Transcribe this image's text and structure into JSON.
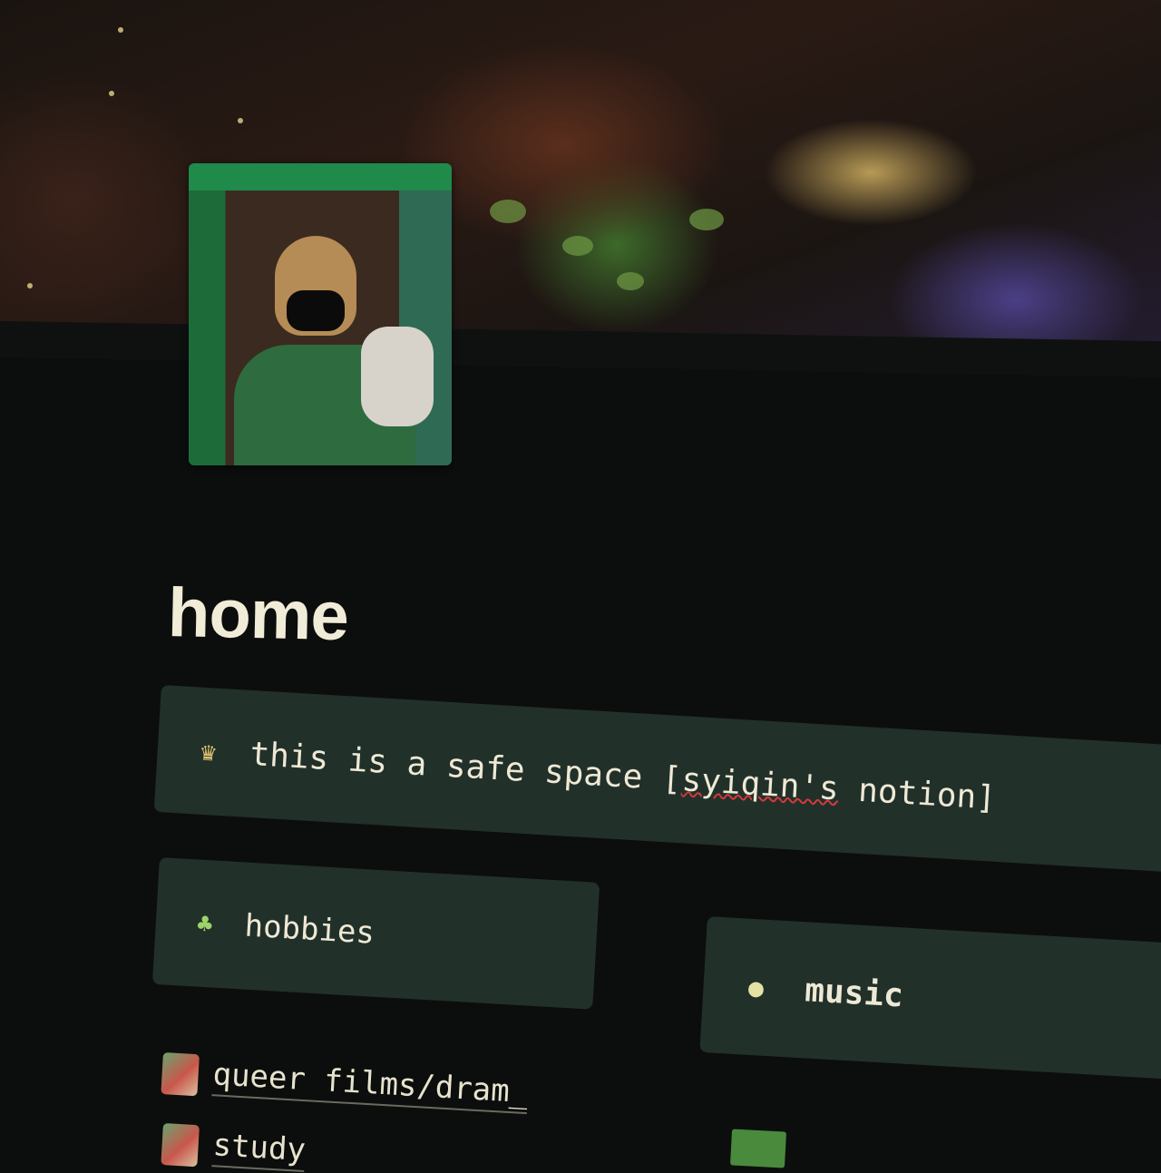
{
  "page": {
    "title": "home"
  },
  "callouts": {
    "safe_space": {
      "icon": "crown-icon",
      "text_before": "this is a safe space [",
      "text_spell": "syiqin's",
      "text_after": " notion]"
    },
    "hobbies": {
      "icon": "cactus-icon",
      "label": "hobbies"
    },
    "music": {
      "icon": "frog-icon",
      "label": "music"
    }
  },
  "links": [
    {
      "label": "queer films/dram_"
    },
    {
      "label": "study"
    }
  ]
}
